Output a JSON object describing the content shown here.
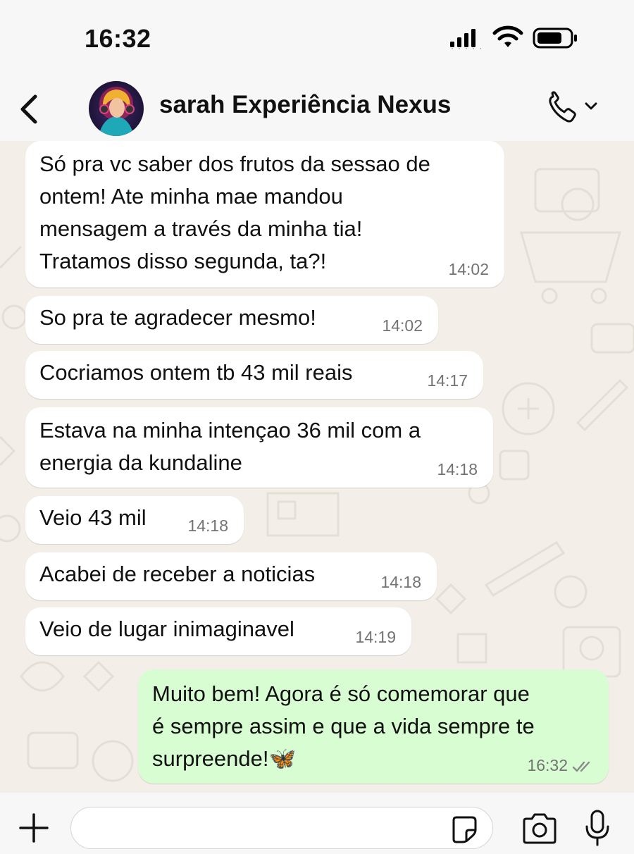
{
  "status": {
    "time": "16:32"
  },
  "header": {
    "contact_name": "sarah Experiência Nexus"
  },
  "messages": [
    {
      "text": "Só pra vc saber dos frutos da sessao de\nontem! Ate minha mae mandou\nmensagem a través da minha tia!\nTratamos disso segunda, ta?!",
      "time": "14:02"
    },
    {
      "text": "So pra te agradecer mesmo!",
      "time": "14:02"
    },
    {
      "text": "Cocriamos ontem tb 43 mil reais",
      "time": "14:17"
    },
    {
      "text": "Estava na minha intençao 36 mil com a\nenergia da kundaline",
      "time": "14:18"
    },
    {
      "text": "Veio 43 mil",
      "time": "14:18"
    },
    {
      "text": "Acabei de receber a noticias",
      "time": "14:18"
    },
    {
      "text": "Veio de lugar inimaginavel",
      "time": "14:19"
    },
    {
      "text": "Muito bem! Agora é só comemorar que\né sempre assim e que a vida sempre te\nsurpreende!🦋",
      "time": "16:32"
    }
  ],
  "composer": {
    "placeholder": ""
  },
  "colors": {
    "incoming_bubble": "#ffffff",
    "outgoing_bubble": "#d9fdd3",
    "background": "#f3efe8",
    "read_ticks": "#8a8a8a"
  }
}
